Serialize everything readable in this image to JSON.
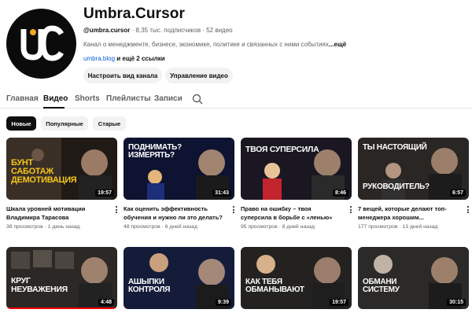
{
  "channel": {
    "name": "Umbra.Cursor",
    "handle": "@umbra.cursor",
    "subscribers": "8,35 тыс. подписчиков",
    "videos_count": "52 видео",
    "separator": "·",
    "description": "Канал о менеджменте, бизнесе, экономике, политике и связанных с ними событиях",
    "description_more": "...ещё",
    "link": "umbra.blog",
    "links_extra": "и ещё 2 ссылки",
    "avatar_text": "UC"
  },
  "actions": {
    "customize": "Настроить вид канала",
    "manage": "Управление видео"
  },
  "tabs": [
    {
      "label": "Главная"
    },
    {
      "label": "Видео"
    },
    {
      "label": "Shorts"
    },
    {
      "label": "Плейлисты"
    },
    {
      "label": "Записи"
    }
  ],
  "chips": [
    {
      "label": "Новые"
    },
    {
      "label": "Популярные"
    },
    {
      "label": "Старые"
    }
  ],
  "videos": [
    {
      "title": "Шкала уровней мотивации Владимира Тарасова",
      "views": "38 просмотров",
      "age": "1 день назад",
      "duration": "19:57",
      "thumb_text": [
        "БУНТ",
        "САБОТАЖ",
        "ДЕМОТИВАЦИЯ"
      ],
      "progress": 0.0
    },
    {
      "title": "Как оценить эффективность обучения и нужно ли это делать?",
      "views": "48 просмотров",
      "age": "6 дней назад",
      "duration": "31:43",
      "thumb_text": [
        "ПОДНИМАТЬ?",
        "ИЗМЕРЯТЬ?"
      ],
      "progress": 0.0
    },
    {
      "title": "Право на ошибку – твоя суперсила в борьбе с «ленью»",
      "views": "95 просмотров",
      "age": "8 дней назад",
      "duration": "8:46",
      "thumb_text": [
        "ТВОЯ СУПЕРСИЛА"
      ],
      "progress": 0.0
    },
    {
      "title": "7 вещей, которые делают топ-менеджера хорошим...",
      "views": "177 просмотров",
      "age": "13 дней назад",
      "duration": "6:57",
      "thumb_text": [
        "ТЫ НАСТОЯЩИЙ",
        "РУКОВОДИТЕЛЬ?"
      ],
      "progress": 0.0
    },
    {
      "title": "",
      "views": "",
      "age": "",
      "duration": "4:48",
      "thumb_text": [
        "КРУГ",
        "НЕУВАЖЕНИЯ"
      ],
      "progress": 1.0
    },
    {
      "title": "",
      "views": "",
      "age": "",
      "duration": "9:39",
      "thumb_text": [
        "АШЫПКИ",
        "КОНТРОЛЯ"
      ],
      "progress": 0.0
    },
    {
      "title": "",
      "views": "",
      "age": "",
      "duration": "19:57",
      "thumb_text": [
        "КАК ТЕБЯ",
        "ОБМАНЫВАЮТ"
      ],
      "progress": 0.0
    },
    {
      "title": "",
      "views": "",
      "age": "",
      "duration": "30:15",
      "thumb_text": [
        "ОБМАНИ",
        "СИСТЕМУ"
      ],
      "progress": 0.0
    }
  ],
  "colors": {
    "accent_red": "#ff0000",
    "link_blue": "#065fd4",
    "avatar_orange": "#f5a623"
  }
}
